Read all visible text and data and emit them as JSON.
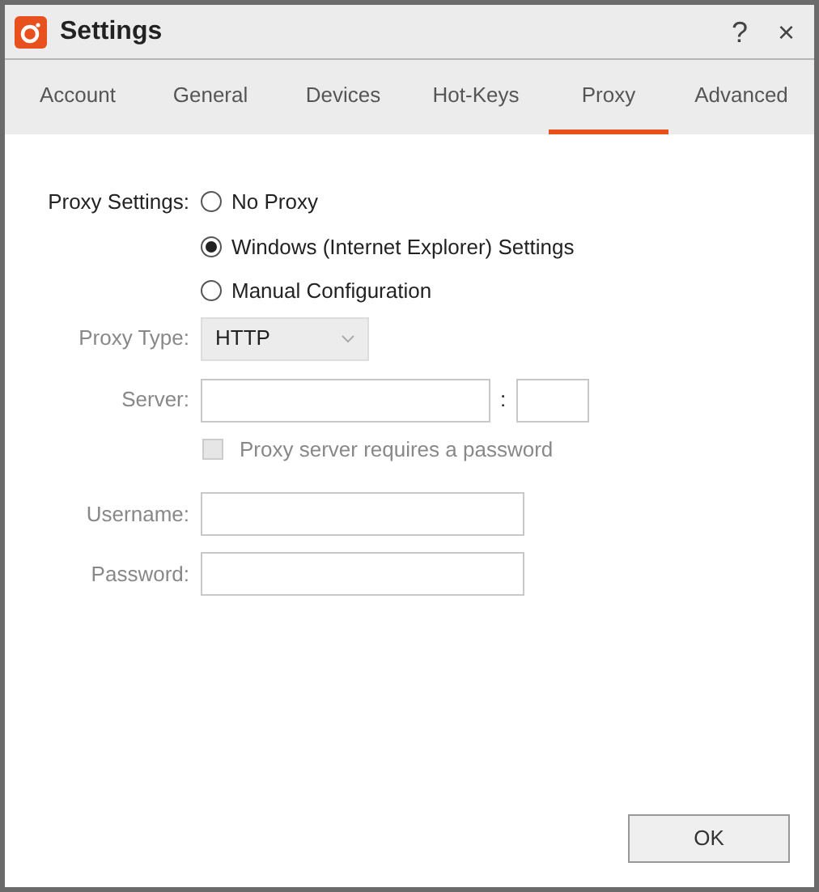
{
  "window": {
    "title": "Settings"
  },
  "title_buttons": [
    {
      "label": "?"
    },
    {
      "label": "×"
    }
  ],
  "tabs": [
    {
      "label": "Account",
      "selected": false
    },
    {
      "label": "General",
      "selected": false
    },
    {
      "label": "Devices",
      "selected": false
    },
    {
      "label": "Hot-Keys",
      "selected": false
    },
    {
      "label": "Proxy",
      "selected": true
    },
    {
      "label": "Advanced",
      "selected": false
    }
  ],
  "proxy_settings": {
    "label": "Proxy Settings:",
    "options": [
      {
        "label": "No Proxy",
        "selected": false
      },
      {
        "label": "Windows (Internet Explorer) Settings",
        "selected": true
      },
      {
        "label": "Manual Configuration",
        "selected": false
      }
    ]
  },
  "proxy_type": {
    "label": "Proxy Type:",
    "value": "HTTP",
    "disabled": true
  },
  "server": {
    "label": "Server:",
    "separator": ":",
    "disabled": true
  },
  "requires_password": {
    "label": "Proxy server requires a password",
    "checked": false,
    "disabled": true
  },
  "username": {
    "label": "Username:",
    "disabled": true
  },
  "password": {
    "label": "Password:",
    "disabled": true
  },
  "buttons": [
    {
      "label": "OK"
    }
  ]
}
